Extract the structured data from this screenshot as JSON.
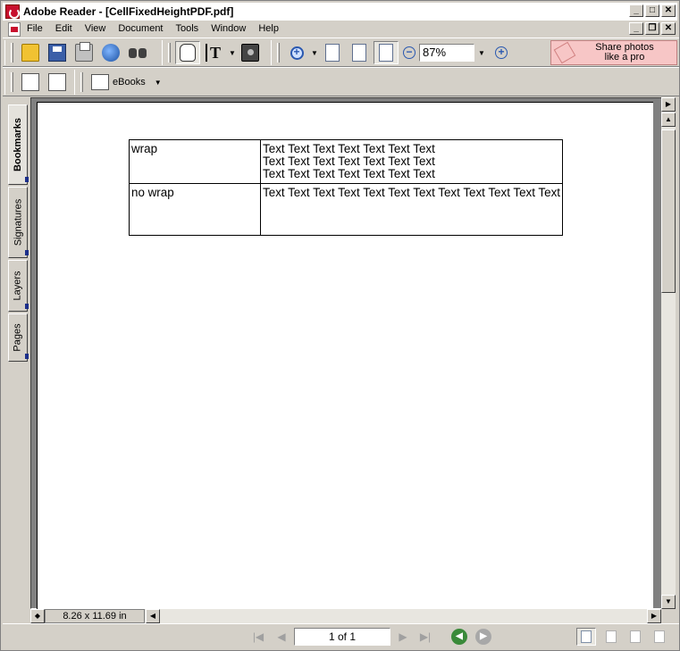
{
  "window": {
    "title": "Adobe Reader - [CellFixedHeightPDF.pdf]"
  },
  "menu": {
    "items": [
      "File",
      "Edit",
      "View",
      "Document",
      "Tools",
      "Window",
      "Help"
    ]
  },
  "toolbar": {
    "zoom_value": "87%",
    "share": {
      "line1": "Share photos",
      "line2": "like a pro"
    },
    "ebooks_label": "eBooks"
  },
  "sidebar": {
    "tabs": [
      "Bookmarks",
      "Signatures",
      "Layers",
      "Pages"
    ]
  },
  "document": {
    "rows": [
      {
        "label": "wrap",
        "text": [
          "Text Text Text Text Text Text Text",
          "Text Text Text Text Text Text Text",
          "Text Text Text Text Text Text Text"
        ]
      },
      {
        "label": "no wrap",
        "text": [
          "Text Text Text Text Text Text Text Text Text Text Text Text"
        ]
      }
    ]
  },
  "status": {
    "page_size": "8.26 x 11.69 in",
    "page_indicator": "1 of 1"
  },
  "colors": {
    "share_bg": "#f7c6c6",
    "back_green": "#3a8a3a",
    "tab_accent": "#1c2f8a"
  }
}
